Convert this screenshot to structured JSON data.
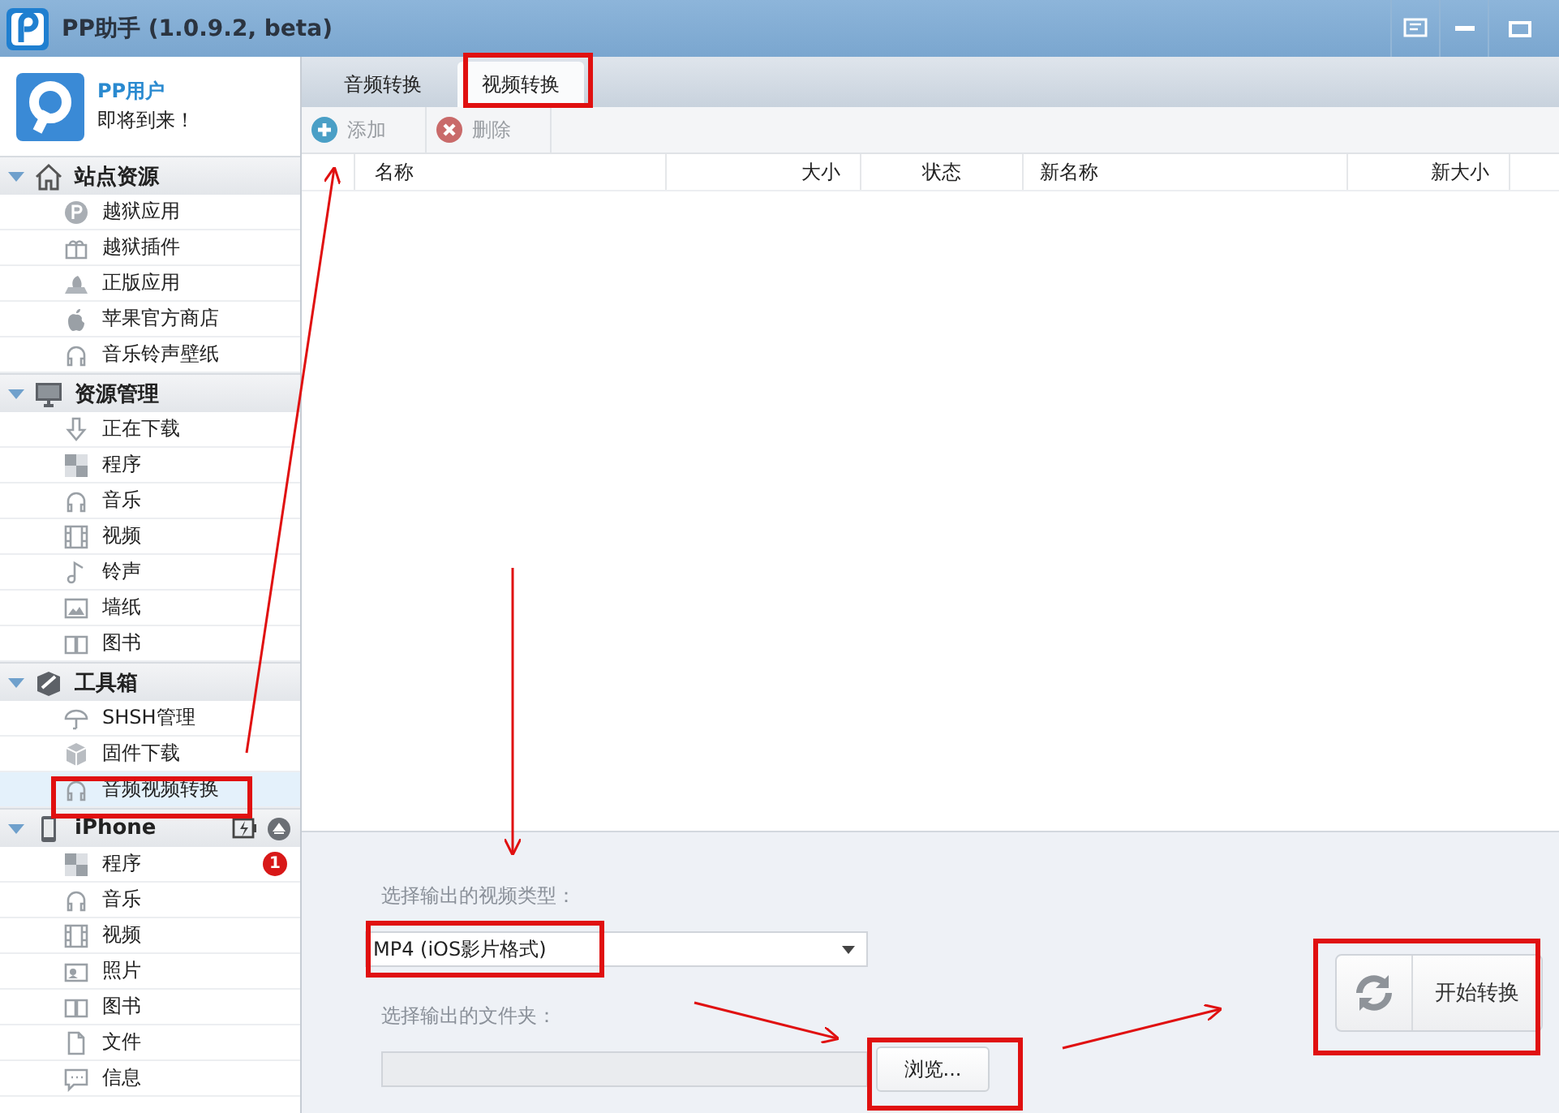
{
  "window": {
    "title": "PP助手 (1.0.9.2, beta)"
  },
  "sidebar": {
    "user": {
      "name": "PP用户",
      "status": "即将到来！"
    },
    "sections": [
      {
        "title": "站点资源",
        "expanded": true,
        "items": [
          {
            "label": "越狱应用",
            "selected": false
          },
          {
            "label": "越狱插件",
            "selected": false
          },
          {
            "label": "正版应用",
            "selected": false
          },
          {
            "label": "苹果官方商店",
            "selected": false
          },
          {
            "label": "音乐铃声壁纸",
            "selected": false
          }
        ]
      },
      {
        "title": "资源管理",
        "expanded": true,
        "items": [
          {
            "label": "正在下载",
            "selected": false
          },
          {
            "label": "程序",
            "selected": false
          },
          {
            "label": "音乐",
            "selected": false
          },
          {
            "label": "视频",
            "selected": false
          },
          {
            "label": "铃声",
            "selected": false
          },
          {
            "label": "墙纸",
            "selected": false
          },
          {
            "label": "图书",
            "selected": false
          }
        ]
      },
      {
        "title": "工具箱",
        "expanded": true,
        "items": [
          {
            "label": "SHSH管理",
            "selected": false
          },
          {
            "label": "固件下载",
            "selected": false
          },
          {
            "label": "音频视频转换",
            "selected": true
          }
        ]
      },
      {
        "title": "iPhone",
        "expanded": true,
        "items": [
          {
            "label": "程序",
            "selected": false,
            "badge": "1"
          },
          {
            "label": "音乐",
            "selected": false
          },
          {
            "label": "视频",
            "selected": false
          },
          {
            "label": "照片",
            "selected": false
          },
          {
            "label": "图书",
            "selected": false
          },
          {
            "label": "文件",
            "selected": false
          },
          {
            "label": "信息",
            "selected": false
          }
        ]
      }
    ]
  },
  "tabs": [
    {
      "label": "音频转换",
      "selected": false
    },
    {
      "label": "视频转换",
      "selected": true
    }
  ],
  "toolbar": [
    {
      "label": "添加",
      "disabled": true
    },
    {
      "label": "删除",
      "disabled": true
    }
  ],
  "table": {
    "columns": [
      "名称",
      "大小",
      "状态",
      "新名称",
      "新大小"
    ]
  },
  "output": {
    "format_label": "选择输出的视频类型：",
    "format": "MP4 (iOS影片格式)",
    "folder_label": "选择输出的文件夹：",
    "browse_button": "浏览...",
    "start_button": "开始转换"
  }
}
